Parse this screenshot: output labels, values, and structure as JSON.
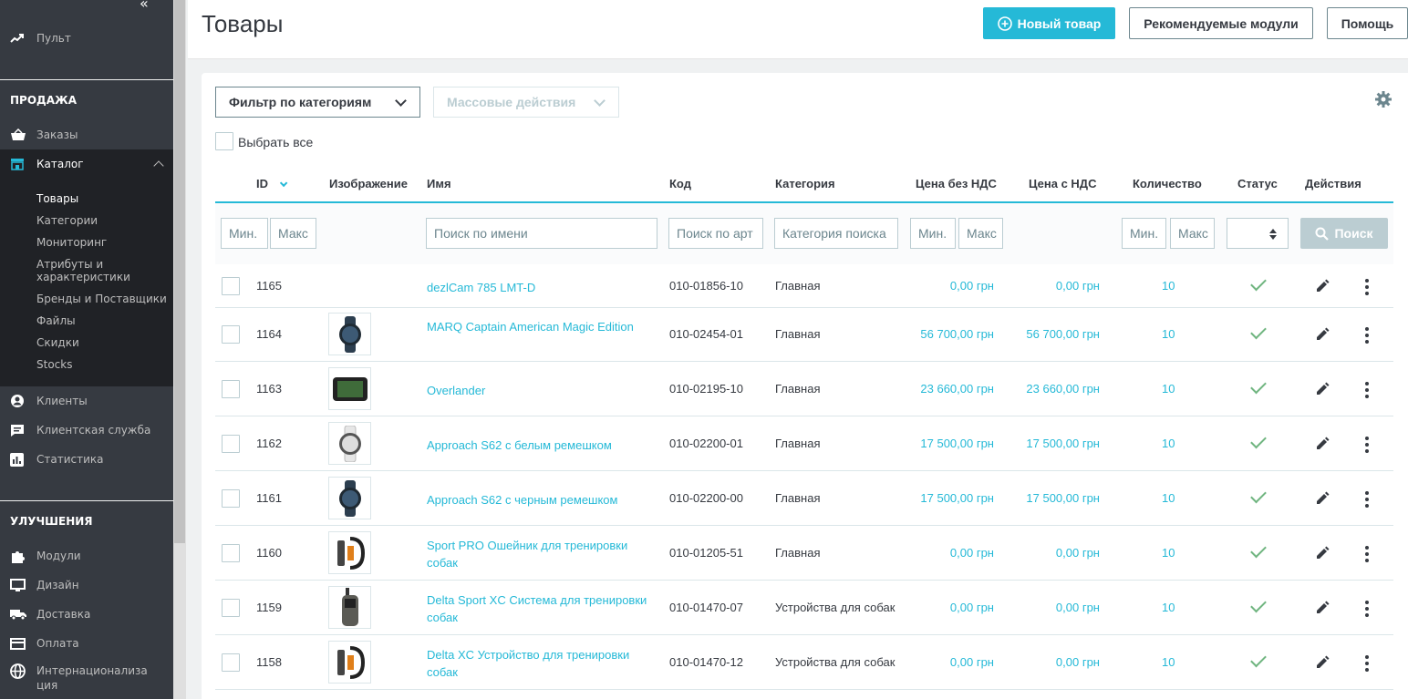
{
  "sidebar": {
    "collapse_label": "«",
    "dashboard": {
      "label": "Пульт",
      "icon": "trending-up-icon"
    },
    "section_sales": "ПРОДАЖА",
    "orders": {
      "label": "Заказы",
      "icon": "basket-icon"
    },
    "catalog": {
      "label": "Каталог",
      "icon": "store-icon"
    },
    "catalog_sub": [
      "Товары",
      "Категории",
      "Мониторинг",
      "Атрибуты и характеристики",
      "Бренды и Поставщики",
      "Файлы",
      "Скидки",
      "Stocks"
    ],
    "customers": {
      "label": "Клиенты",
      "icon": "account-icon"
    },
    "service": {
      "label": "Клиентская служба",
      "icon": "chat-icon"
    },
    "stats": {
      "label": "Статистика",
      "icon": "bar-chart-icon"
    },
    "section_improve": "УЛУЧШЕНИЯ",
    "modules": {
      "label": "Модули",
      "icon": "puzzle-icon"
    },
    "design": {
      "label": "Дизайн",
      "icon": "desktop-icon"
    },
    "shipping": {
      "label": "Доставка",
      "icon": "truck-icon"
    },
    "payment": {
      "label": "Оплата",
      "icon": "credit-card-icon"
    },
    "intl": {
      "label": "Интернационализация",
      "icon": "globe-icon"
    }
  },
  "header": {
    "title": "Товары",
    "new_product": "Новый товар",
    "recommended": "Рекомендуемые модули",
    "help": "Помощь"
  },
  "toolbar": {
    "category_filter": "Фильтр по категориям",
    "bulk_actions": "Массовые действия",
    "select_all": "Выбрать все"
  },
  "columns": {
    "id": "ID",
    "image": "Изображение",
    "name": "Имя",
    "code": "Код",
    "category": "Категория",
    "price_net": "Цена без НДС",
    "price_gross": "Цена с НДС",
    "quantity": "Количество",
    "status": "Статус",
    "actions": "Действия"
  },
  "filters": {
    "id_min": "Мин.",
    "id_max": "Макс",
    "name": "Поиск по имени",
    "code": "Поиск по арт",
    "category": "Категория поиска",
    "price_min": "Мин.",
    "price_max": "Макс",
    "qty_min": "Мин.",
    "qty_max": "Макс",
    "search": "Поиск"
  },
  "products": [
    {
      "id": "1165",
      "name": "dezlCam 785 LMT-D",
      "code": "010-01856-10",
      "category": "Главная",
      "price_net": "0,00 грн",
      "price_gross": "0,00 грн",
      "qty": "10",
      "image": ""
    },
    {
      "id": "1164",
      "name": "MARQ Captain American Magic Edition",
      "code": "010-02454-01",
      "category": "Главная",
      "price_net": "56 700,00 грн",
      "price_gross": "56 700,00 грн",
      "qty": "10",
      "image": "watch-dark"
    },
    {
      "id": "1163",
      "name": "Overlander",
      "code": "010-02195-10",
      "category": "Главная",
      "price_net": "23 660,00 грн",
      "price_gross": "23 660,00 грн",
      "qty": "10",
      "image": "gps-device"
    },
    {
      "id": "1162",
      "name": "Approach S62 с белым ремешком",
      "code": "010-02200-01",
      "category": "Главная",
      "price_net": "17 500,00 грн",
      "price_gross": "17 500,00 грн",
      "qty": "10",
      "image": "watch-white"
    },
    {
      "id": "1161",
      "name": "Approach S62 с черным ремешком",
      "code": "010-02200-00",
      "category": "Главная",
      "price_net": "17 500,00 грн",
      "price_gross": "17 500,00 грн",
      "qty": "10",
      "image": "watch-dark"
    },
    {
      "id": "1160",
      "name": "Sport PRO Ошейник для тренировки собак",
      "code": "010-01205-51",
      "category": "Главная",
      "price_net": "0,00 грн",
      "price_gross": "0,00 грн",
      "qty": "10",
      "image": "collar"
    },
    {
      "id": "1159",
      "name": "Delta Sport XC Система для тренировки собак",
      "code": "010-01470-07",
      "category": "Устройства для собак",
      "price_net": "0,00 грн",
      "price_gross": "0,00 грн",
      "qty": "10",
      "image": "handheld"
    },
    {
      "id": "1158",
      "name": "Delta XC Устройство для тренировки собак",
      "code": "010-01470-12",
      "category": "Устройства для собак",
      "price_net": "0,00 грн",
      "price_gross": "0,00 грн",
      "qty": "10",
      "image": "collar"
    }
  ],
  "colors": {
    "accent": "#25b9d7",
    "success": "#70b580",
    "sidebar": "#363a41"
  }
}
